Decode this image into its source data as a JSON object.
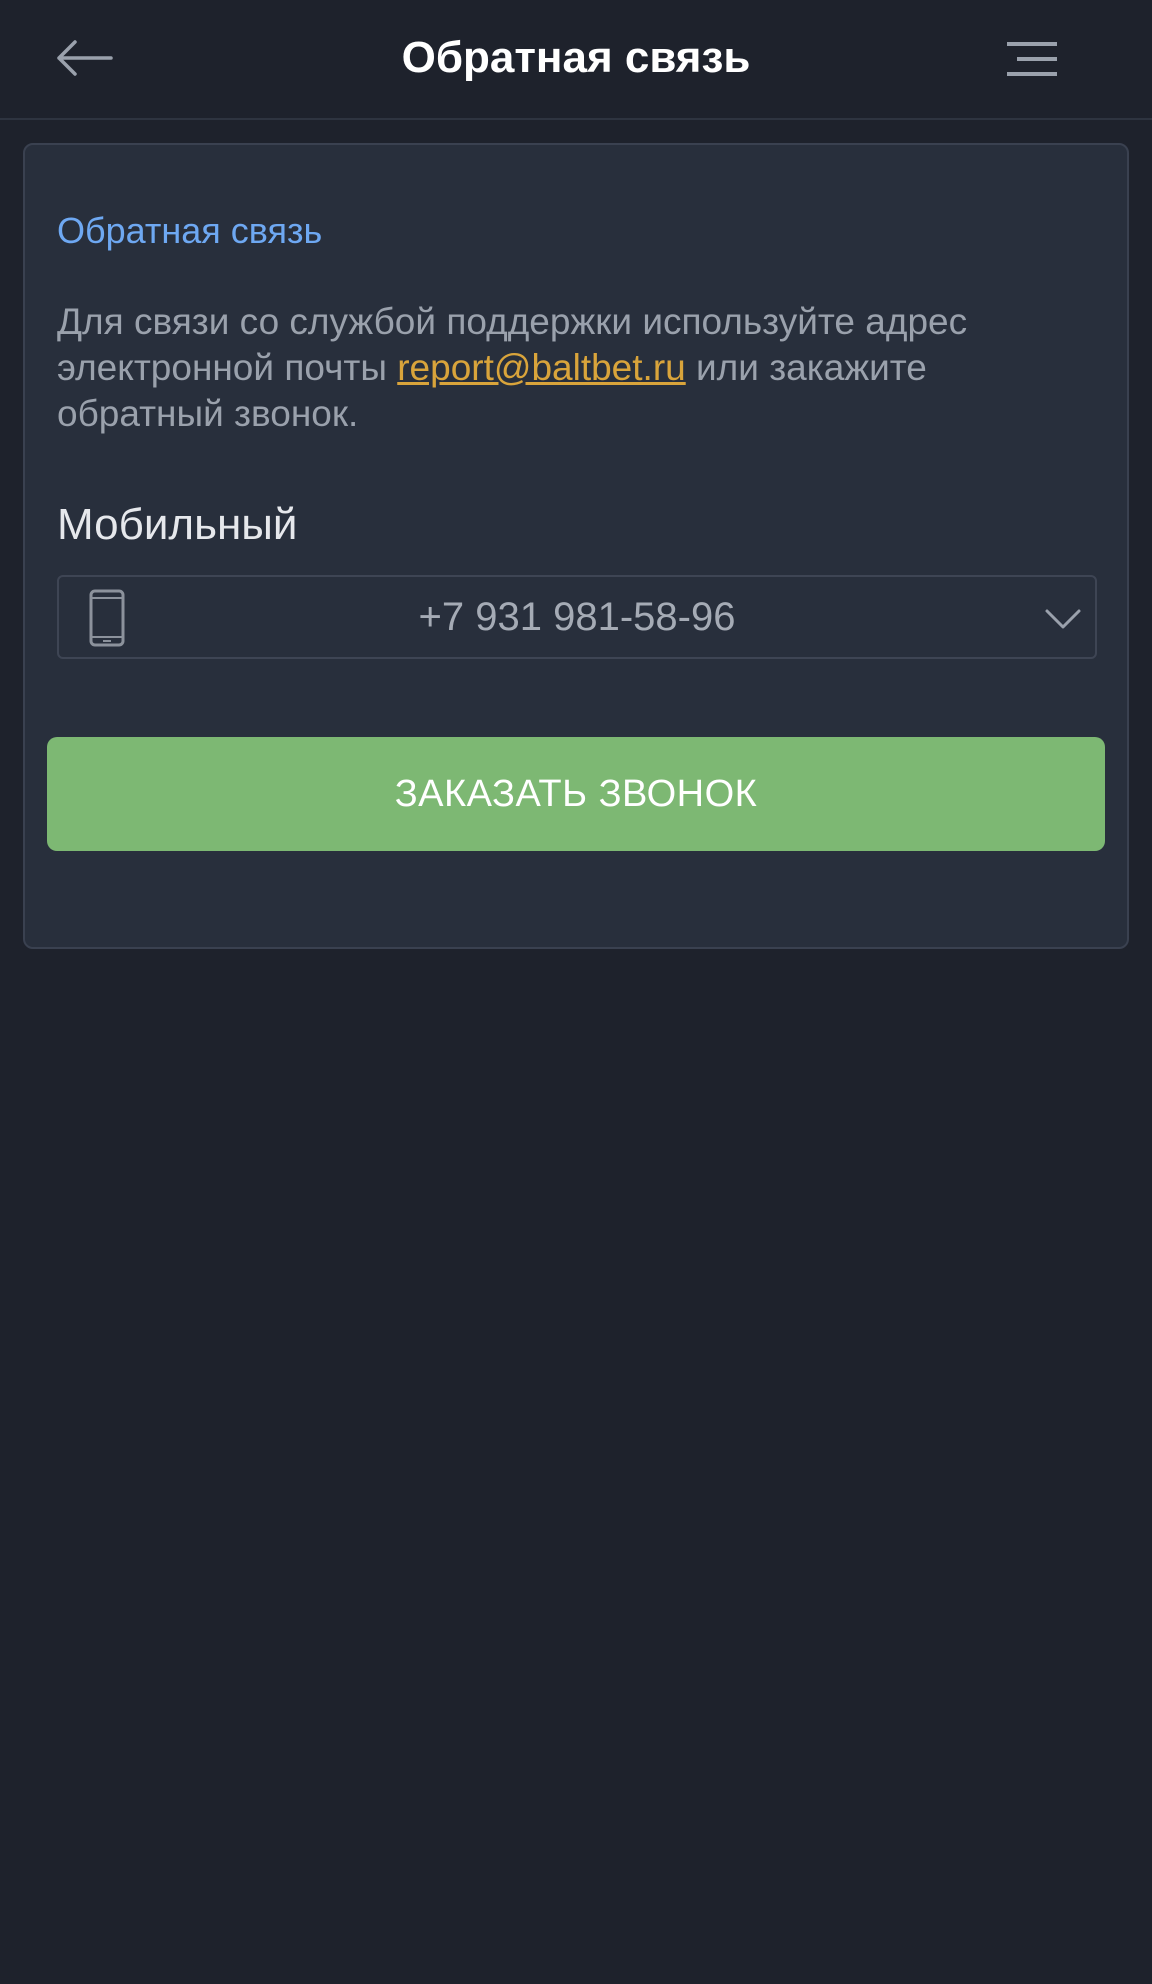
{
  "header": {
    "title": "Обратная связь",
    "back_icon": "arrow-left-icon",
    "menu_icon": "menu-icon"
  },
  "feedback": {
    "title": "Обратная связь",
    "description_before": "Для связи со службой поддержки используйте адрес электронной почты ",
    "email": "report@baltbet.ru",
    "description_after": " или закажите обратный звонок.",
    "phone_label": "Мобильный",
    "phone_value": "+7 931 981-58-96",
    "phone_icon": "smartphone-icon",
    "dropdown_icon": "chevron-down-icon",
    "button_label": "ЗАКАЗАТЬ ЗВОНОК"
  },
  "colors": {
    "background": "#1e222c",
    "card": "#282f3c",
    "accent_blue": "#6ea8f2",
    "link": "#d9a43b",
    "button": "#7db873"
  }
}
